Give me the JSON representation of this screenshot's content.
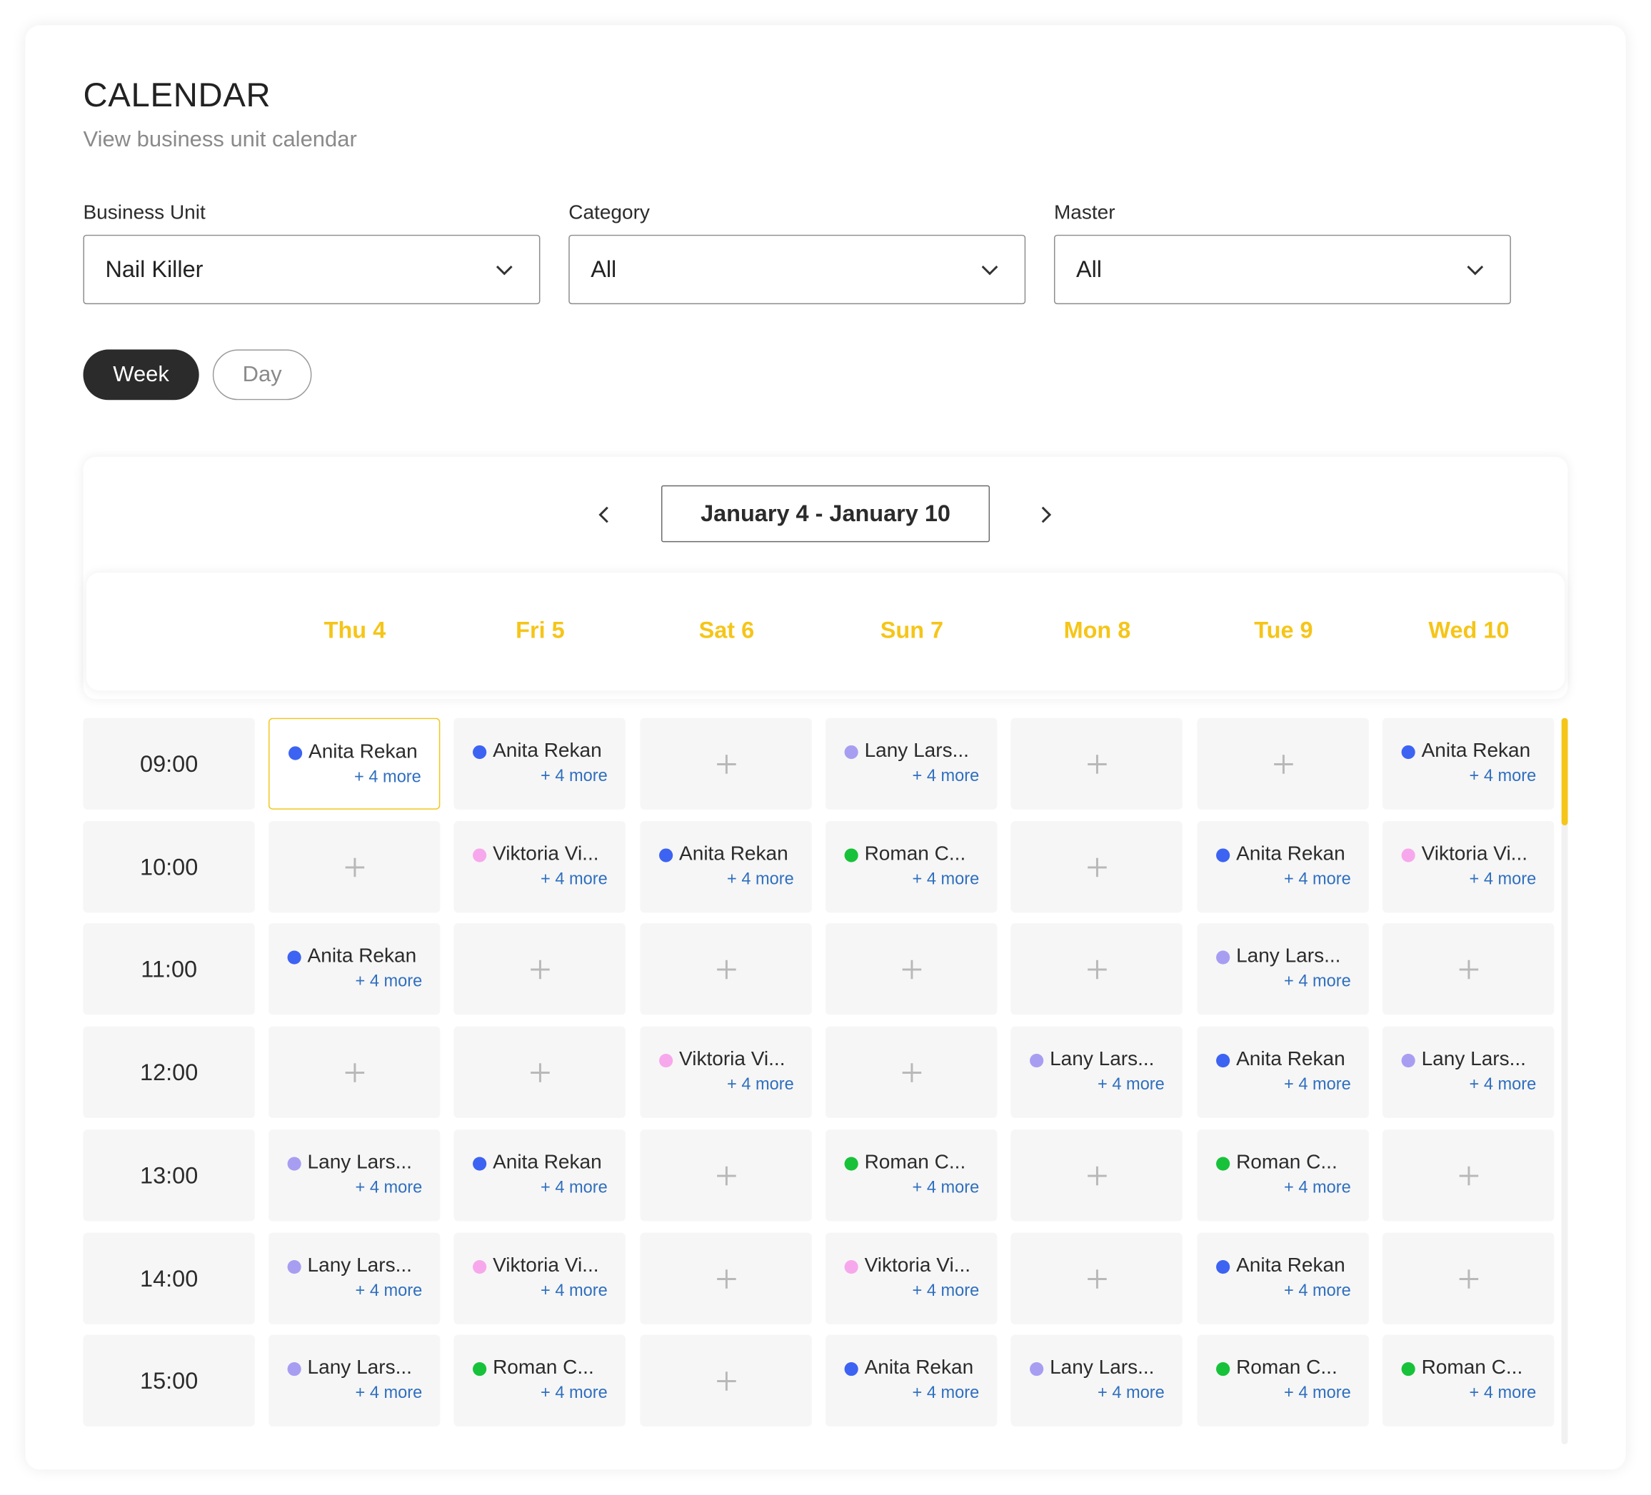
{
  "header": {
    "title": "CALENDAR",
    "subtitle": "View business unit calendar"
  },
  "filters": [
    {
      "label": "Business Unit",
      "value": "Nail Killer"
    },
    {
      "label": "Category",
      "value": "All"
    },
    {
      "label": "Master",
      "value": "All"
    }
  ],
  "view_toggle": {
    "week": "Week",
    "day": "Day",
    "selected": "Week"
  },
  "range": {
    "start": "January 4",
    "separator": " - ",
    "end": "January 10"
  },
  "days": [
    "Thu 4",
    "Fri 5",
    "Sat 6",
    "Sun 7",
    "Mon 8",
    "Tue 9",
    "Wed 10"
  ],
  "colors": {
    "accent": "#f5c518",
    "more_link": "#2f6fbf",
    "Anita": "#3d63f2",
    "Viktoria": "#f7a8ec",
    "Roman": "#17c23a",
    "Lany": "#a79ef2"
  },
  "more_label": "+ 4 more",
  "selected_slot": "09:00|0",
  "rows": [
    {
      "time": "09:00",
      "slots": [
        {
          "name": "Anita Rekan",
          "color": "Anita"
        },
        {
          "name": "Anita Rekan",
          "color": "Anita"
        },
        null,
        {
          "name": "Lany Lars...",
          "color": "Lany"
        },
        null,
        null,
        {
          "name": "Anita Rekan",
          "color": "Anita"
        }
      ]
    },
    {
      "time": "10:00",
      "slots": [
        null,
        {
          "name": "Viktoria Vi...",
          "color": "Viktoria"
        },
        {
          "name": "Anita Rekan",
          "color": "Anita"
        },
        {
          "name": "Roman C...",
          "color": "Roman"
        },
        null,
        {
          "name": "Anita Rekan",
          "color": "Anita"
        },
        {
          "name": "Viktoria Vi...",
          "color": "Viktoria"
        }
      ]
    },
    {
      "time": "11:00",
      "slots": [
        {
          "name": "Anita Rekan",
          "color": "Anita"
        },
        null,
        null,
        null,
        null,
        {
          "name": "Lany Lars...",
          "color": "Lany"
        },
        null
      ]
    },
    {
      "time": "12:00",
      "slots": [
        null,
        null,
        {
          "name": "Viktoria Vi...",
          "color": "Viktoria"
        },
        null,
        {
          "name": "Lany Lars...",
          "color": "Lany"
        },
        {
          "name": "Anita Rekan",
          "color": "Anita"
        },
        {
          "name": "Lany Lars...",
          "color": "Lany"
        }
      ]
    },
    {
      "time": "13:00",
      "slots": [
        {
          "name": "Lany Lars...",
          "color": "Lany"
        },
        {
          "name": "Anita Rekan",
          "color": "Anita"
        },
        null,
        {
          "name": "Roman C...",
          "color": "Roman"
        },
        null,
        {
          "name": "Roman C...",
          "color": "Roman"
        },
        null
      ]
    },
    {
      "time": "14:00",
      "slots": [
        {
          "name": "Lany Lars...",
          "color": "Lany"
        },
        {
          "name": "Viktoria Vi...",
          "color": "Viktoria"
        },
        null,
        {
          "name": "Viktoria Vi...",
          "color": "Viktoria"
        },
        null,
        {
          "name": "Anita Rekan",
          "color": "Anita"
        },
        null
      ]
    },
    {
      "time": "15:00",
      "slots": [
        {
          "name": "Lany Lars...",
          "color": "Lany"
        },
        {
          "name": "Roman C...",
          "color": "Roman"
        },
        null,
        {
          "name": "Anita Rekan",
          "color": "Anita"
        },
        {
          "name": "Lany Lars...",
          "color": "Lany"
        },
        {
          "name": "Roman C...",
          "color": "Roman"
        },
        {
          "name": "Roman C...",
          "color": "Roman"
        }
      ]
    }
  ]
}
